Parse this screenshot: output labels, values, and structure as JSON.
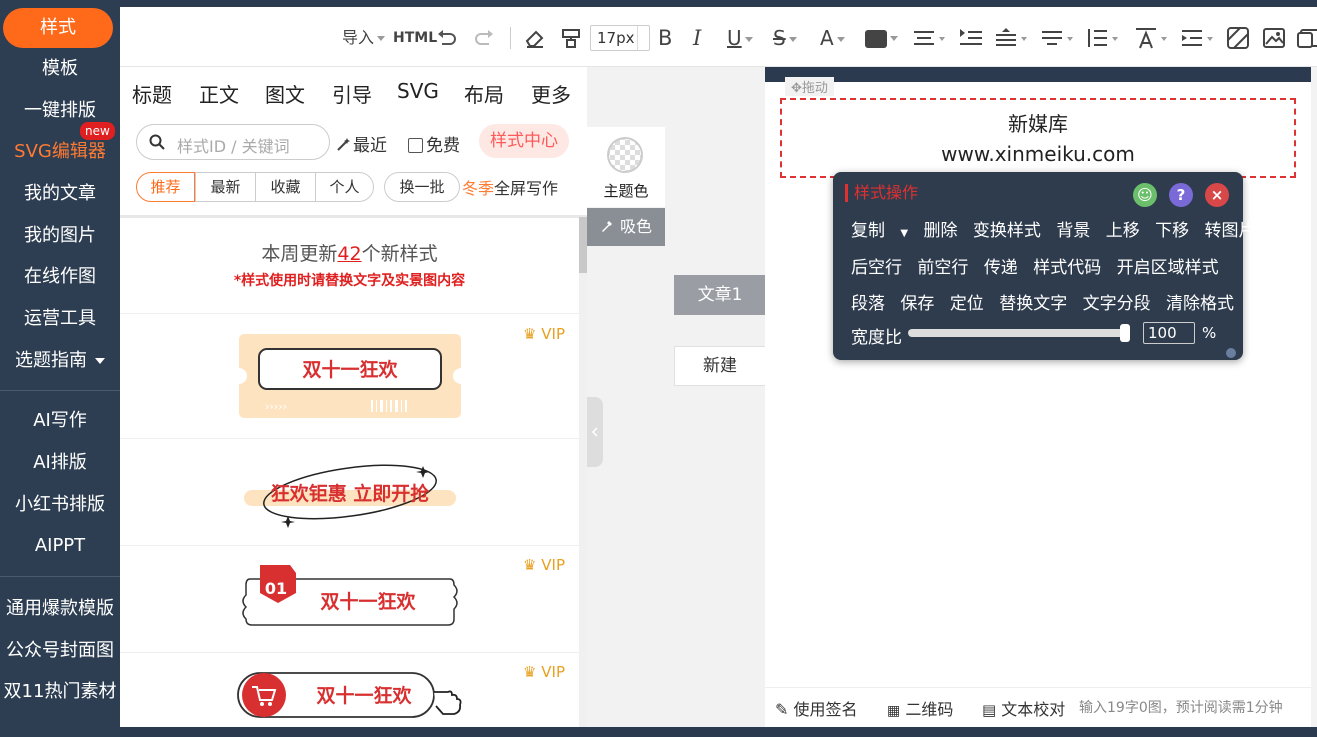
{
  "sidebar": {
    "items": [
      {
        "label": "样式"
      },
      {
        "label": "模板"
      },
      {
        "label": "一键排版"
      },
      {
        "label": "SVG编辑器"
      },
      {
        "label": "我的文章"
      },
      {
        "label": "我的图片"
      },
      {
        "label": "在线作图"
      },
      {
        "label": "运营工具"
      },
      {
        "label": "选题指南"
      },
      {
        "label": "AI写作"
      },
      {
        "label": "AI排版"
      },
      {
        "label": "小红书排版"
      },
      {
        "label": "AIPPT"
      },
      {
        "label": "通用爆款模版"
      },
      {
        "label": "公众号封面图"
      },
      {
        "label": "双11热门素材"
      }
    ],
    "new_badge": "new"
  },
  "toolbar": {
    "import_label": "导入",
    "html_label": "HTML",
    "font_size": "17px",
    "bold": "B",
    "italic": "I",
    "underline": "U",
    "strike": "S",
    "font_color": "A"
  },
  "panel": {
    "tabs": [
      "标题",
      "正文",
      "图文",
      "引导",
      "SVG",
      "布局",
      "更多"
    ],
    "search_placeholder": "样式ID / 关键词",
    "recent": "最近",
    "free": "免费",
    "style_center": "样式中心",
    "filters": [
      "推荐",
      "最新",
      "收藏",
      "个人"
    ],
    "batch": "换一批",
    "winter_prefix": "冬季",
    "winter_suffix": "全屏写作",
    "notice_prefix": "本周更新",
    "notice_count": "42",
    "notice_suffix": "个新样式",
    "notice_warning": "*样式使用时请替换文字及实景图内容",
    "vip": "VIP",
    "cards": [
      {
        "text": "双十一狂欢"
      },
      {
        "text": "狂欢钜惠 立即开抢"
      },
      {
        "text": "双十一狂欢",
        "badge": "01"
      },
      {
        "text": "双十一狂欢"
      }
    ]
  },
  "middle": {
    "theme_color": "主题色",
    "pick_color": "吸色",
    "article": "文章1",
    "new": "新建"
  },
  "editor": {
    "drag_hint": "拖动",
    "line1": "新媒库",
    "line2": "www.xinmeiku.com"
  },
  "popup": {
    "title": "样式操作",
    "row1": [
      "复制",
      "删除",
      "变换样式",
      "背景",
      "上移",
      "下移",
      "转图片"
    ],
    "row2": [
      "后空行",
      "前空行",
      "传递",
      "样式代码",
      "开启区域样式"
    ],
    "row3": [
      "段落",
      "保存",
      "定位",
      "替换文字",
      "文字分段",
      "清除格式"
    ],
    "width_label": "宽度比",
    "width_value": "100",
    "width_fraction": 1.0,
    "percent": "%"
  },
  "footer": {
    "signature": "使用签名",
    "qrcode": "二维码",
    "proofread": "文本校对",
    "stats": "输入19字0图，预计阅读需1分钟"
  },
  "colors": {
    "accent": "#ff6a1a",
    "sidebar_bg": "#2d3e52",
    "popup_bg": "#2f3c4e",
    "danger": "#e02020"
  }
}
